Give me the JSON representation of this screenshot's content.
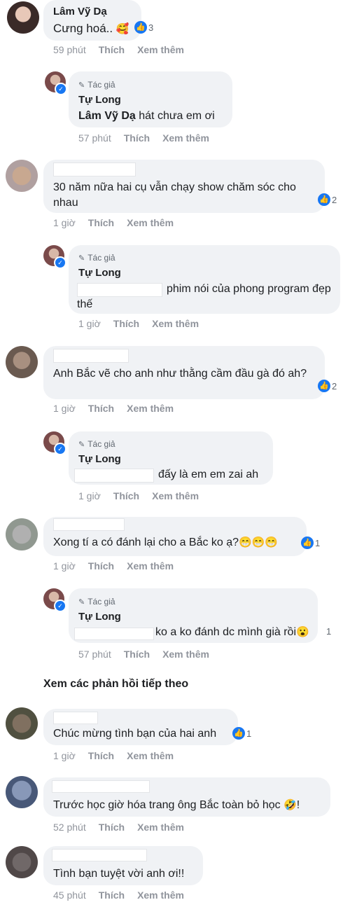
{
  "comments": [
    {
      "name": "Lâm Vỹ Dạ",
      "text": "Cưng hoá..",
      "reaction_count": "3",
      "time": "59 phút",
      "like": "Thích",
      "more": "Xem thêm"
    },
    {
      "author_badge": "Tác giả",
      "name": "Tự Long",
      "mention": "Lâm Vỹ Dạ",
      "text": " hát chưa em ơi",
      "time": "57 phút",
      "like": "Thích",
      "more": "Xem thêm"
    },
    {
      "text": "30 năm nữa hai cụ vẫn chạy show chăm sóc cho nhau",
      "reaction_count": "2",
      "time": "1 giờ",
      "like": "Thích",
      "more": "Xem thêm"
    },
    {
      "author_badge": "Tác giả",
      "name": "Tự Long",
      "text": "phim nói của phong program đẹp thế",
      "time": "1 giờ",
      "like": "Thích",
      "more": "Xem thêm"
    },
    {
      "text": "Anh Bắc vẽ cho anh như thằng cầm đầu gà đó ah?",
      "reaction_count": "2",
      "time": "1 giờ",
      "like": "Thích",
      "more": "Xem thêm"
    },
    {
      "author_badge": "Tác giả",
      "name": "Tự Long",
      "text": "đấy là em em zai ah",
      "time": "1 giờ",
      "like": "Thích",
      "more": "Xem thêm"
    },
    {
      "text": "Xong tí a có đánh lại cho a Bắc ko ạ?",
      "reaction_count": "1",
      "time": "1 giờ",
      "like": "Thích",
      "more": "Xem thêm"
    },
    {
      "author_badge": "Tác giả",
      "name": "Tự Long",
      "text": "ko a ko đánh dc mình già rồi",
      "reaction_count": "1",
      "time": "57 phút",
      "like": "Thích",
      "more": "Xem thêm"
    },
    {
      "text": "Chúc mừng tình bạn của hai anh",
      "reaction_count": "1",
      "time": "1 giờ",
      "like": "Thích",
      "more": "Xem thêm"
    },
    {
      "text": "Trước học giờ hóa trang ông Bắc toàn bỏ học",
      "text_end": "!",
      "time": "52 phút",
      "like": "Thích",
      "more": "Xem thêm"
    },
    {
      "text": "Tình bạn tuyệt vời anh ơi!!",
      "time": "45 phút",
      "like": "Thích",
      "more": "Xem thêm"
    }
  ],
  "more_replies": "Xem các phản hồi tiếp theo",
  "colors": {
    "bubble": "#f0f2f5",
    "like_blue": "#1877f2",
    "meta_gray": "#90949c"
  },
  "icons": [
    "like-icon",
    "pencil-icon",
    "verified-icon",
    "grin-emoji-icon",
    "wow-emoji-icon",
    "laugh-emoji-icon",
    "smiling-hearts-emoji-icon"
  ]
}
